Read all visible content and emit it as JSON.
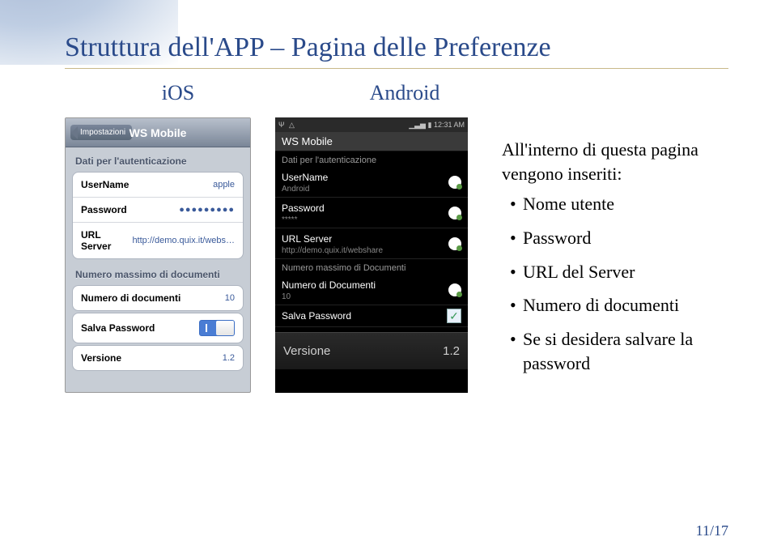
{
  "page": {
    "title": "Struttura dell'APP – Pagina delle Preferenze",
    "sub_ios": "iOS",
    "sub_android": "Android",
    "page_number": "11/17"
  },
  "ios": {
    "back": "Impostazioni",
    "nav_title": "WS Mobile",
    "section_auth": "Dati per l'autenticazione",
    "rows": {
      "username_label": "UserName",
      "username_value": "apple",
      "password_label": "Password",
      "password_value": "●●●●●●●●●",
      "urlserver_label": "URL Server",
      "urlserver_value": "http://demo.quix.it/webs…"
    },
    "section_docs": "Numero massimo di documenti",
    "docs_label": "Numero di documenti",
    "docs_value": "10",
    "save_pw_label": "Salva Password",
    "version_label": "Versione",
    "version_value": "1.2"
  },
  "android": {
    "status_time": "12:31 AM",
    "title": "WS Mobile",
    "section_auth": "Dati per l'autenticazione",
    "username_label": "UserName",
    "username_value": "Android",
    "password_label": "Password",
    "password_value": "*****",
    "url_label": "URL Server",
    "url_value": "http://demo.quix.it/webshare",
    "section_docs": "Numero massimo di Documenti",
    "docs_label": "Numero di Documenti",
    "docs_value": "10",
    "save_pw_label": "Salva Password",
    "version_label": "Versione",
    "version_value": "1.2"
  },
  "desc": {
    "intro": "All'interno di questa pagina vengono inseriti:",
    "items": [
      "Nome utente",
      "Password",
      "URL del Server",
      "Numero di documenti",
      "Se si desidera salvare la password"
    ]
  }
}
